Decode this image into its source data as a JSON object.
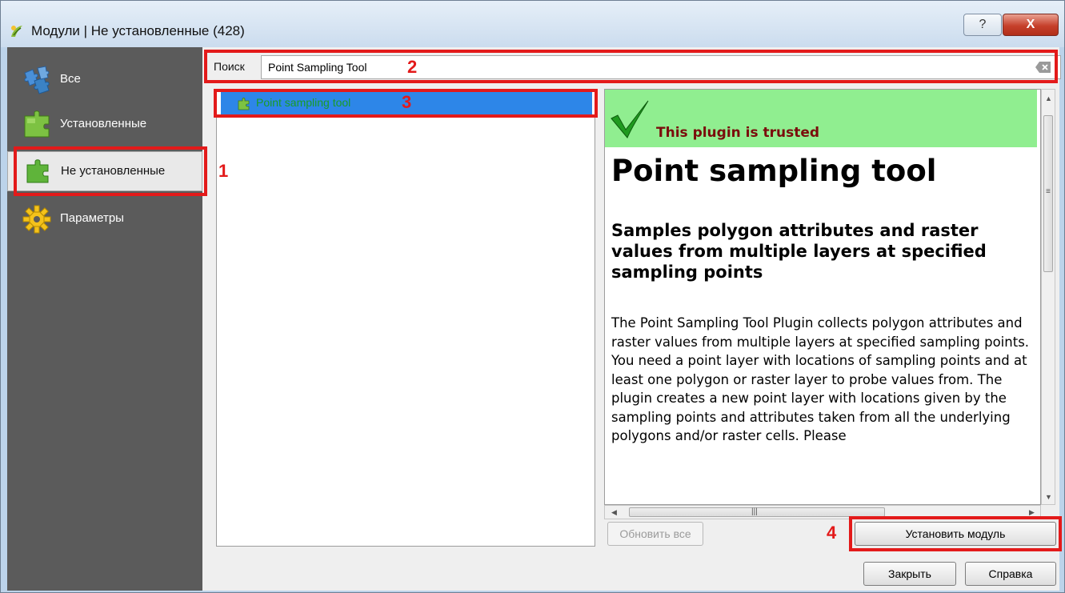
{
  "window": {
    "title": "Модули | Не установленные (428)",
    "help_glyph": "?",
    "close_glyph": "X"
  },
  "sidebar": {
    "items": [
      {
        "label": "Все",
        "icon": "puzzle-blue-icon"
      },
      {
        "label": "Установленные",
        "icon": "puzzle-green-icon"
      },
      {
        "label": "Не установленные",
        "icon": "puzzle-green-icon",
        "selected": true
      },
      {
        "label": "Параметры",
        "icon": "gear-icon"
      }
    ]
  },
  "search": {
    "label": "Поиск",
    "value": "Point Sampling Tool"
  },
  "plugin_list": {
    "items": [
      {
        "label": "Point sampling tool",
        "selected": true
      }
    ]
  },
  "details": {
    "trusted_text": "This plugin is trusted",
    "plugin_name": "Point sampling tool",
    "summary": "Samples polygon attributes and raster values from multiple layers at specified sampling points",
    "description": "The Point Sampling Tool Plugin collects polygon attributes and raster values from multiple layers at specified sampling points. You need a point layer with locations of sampling points and at least one polygon or raster layer to probe values from. The plugin creates a new point layer with locations given by the sampling points and attributes taken from all the underlying polygons and/or raster cells. Please"
  },
  "buttons": {
    "upgrade_all": "Обновить все",
    "install": "Установить модуль",
    "close": "Закрыть",
    "help": "Справка"
  },
  "annotations": [
    "1",
    "2",
    "3",
    "4"
  ],
  "colors": {
    "sidebar_bg": "#5b5b5b",
    "selection_blue": "#2d86e8",
    "trusted_green": "#90ee90",
    "trusted_text": "#7a0c0c",
    "highlight_red": "#e31a1a",
    "plugin_label_green": "#1a9c27"
  }
}
